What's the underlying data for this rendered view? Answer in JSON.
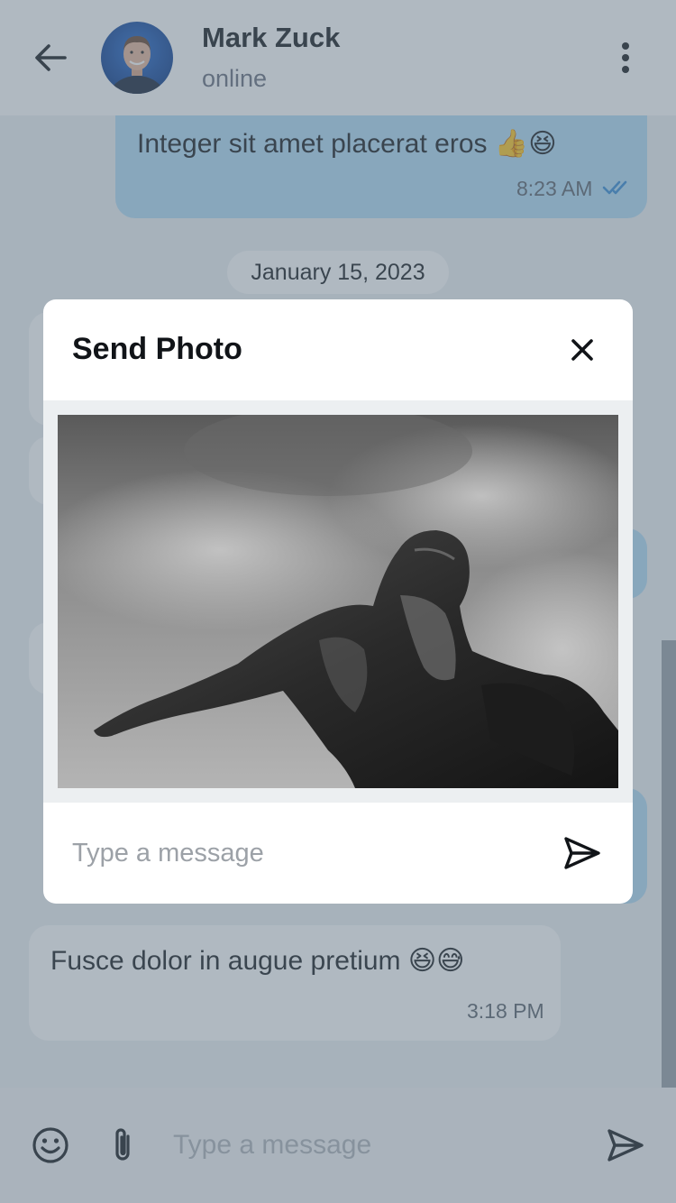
{
  "header": {
    "contact_name": "Mark Zuck",
    "status": "online"
  },
  "messages": {
    "top_outgoing": {
      "text": "Integer sit amet placerat eros 👍😆",
      "time": "8:23 AM"
    },
    "date_separator": "January 15, 2023",
    "bottom_incoming": {
      "text": "Fusce dolor in augue pretium 😆😅",
      "time": "3:18 PM"
    }
  },
  "composer": {
    "placeholder": "Type a message"
  },
  "dialog": {
    "title": "Send Photo",
    "caption_placeholder": "Type a message"
  },
  "icons": {
    "back": "arrow-left-icon",
    "menu": "more-vertical-icon",
    "read": "double-check-icon",
    "close": "close-icon",
    "send": "send-icon",
    "emoji": "smiley-icon",
    "attach": "paperclip-icon"
  },
  "colors": {
    "outgoing_bubble": "#b3dcf6",
    "read_check": "#3b8fd6",
    "overlay": "#5a6c7d"
  }
}
